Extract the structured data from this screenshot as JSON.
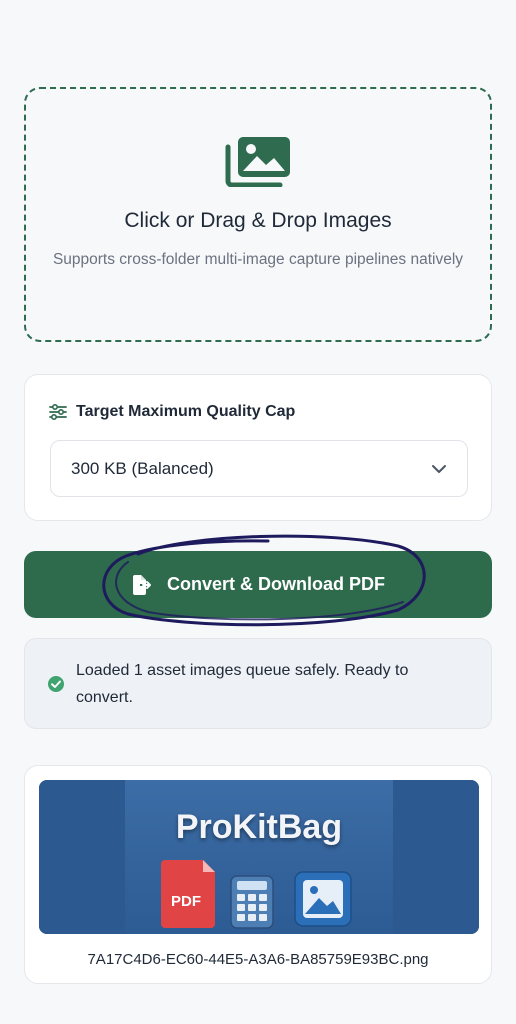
{
  "dropzone": {
    "icon": "images-icon",
    "title": "Click or Drag & Drop Images",
    "subtitle": "Supports cross-folder multi-image capture pipelines natively"
  },
  "settings": {
    "label_icon": "sliders-icon",
    "label": "Target Maximum Quality Cap",
    "select_value": "300 KB (Balanced)",
    "select_icon": "chevron-down-icon"
  },
  "convert": {
    "icon": "file-export-icon",
    "label": "Convert & Download PDF",
    "color": "#2e6a4c"
  },
  "status": {
    "icon": "check-circle-icon",
    "text": "Loaded 1 asset images queue safely. Ready to convert.",
    "color": "#3fa46f"
  },
  "preview": {
    "brand_text": "ProKitBag",
    "pdf_tile_text": "PDF",
    "filename": "7A17C4D6-EC60-44E5-A3A6-BA85759E93BC.png"
  }
}
